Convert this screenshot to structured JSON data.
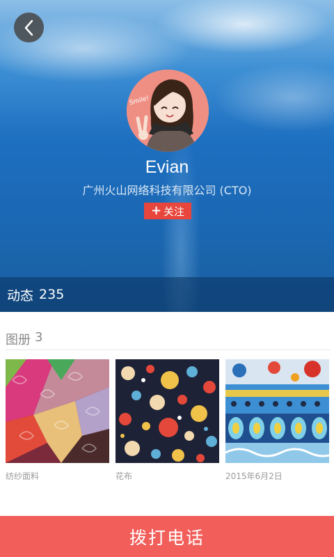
{
  "profile": {
    "name": "Evian",
    "company": "广州火山网络科技有限公司 (CTO)",
    "follow_label": "关注",
    "avatar_sign_text": "Smile!"
  },
  "activity": {
    "label": "动态",
    "count": "235"
  },
  "albums": {
    "label": "图册",
    "count": "3",
    "items": [
      {
        "caption": "纺纱面料"
      },
      {
        "caption": "花布"
      },
      {
        "caption": "2015年6月2日"
      }
    ]
  },
  "actions": {
    "call_label": "拨打电话"
  },
  "colors": {
    "follow_button": "#e8453c",
    "call_button": "#f25e5a",
    "avatar_bg": "#ef8f84"
  },
  "icons": {
    "back": "chevron-left-icon",
    "follow": "plus-icon"
  }
}
